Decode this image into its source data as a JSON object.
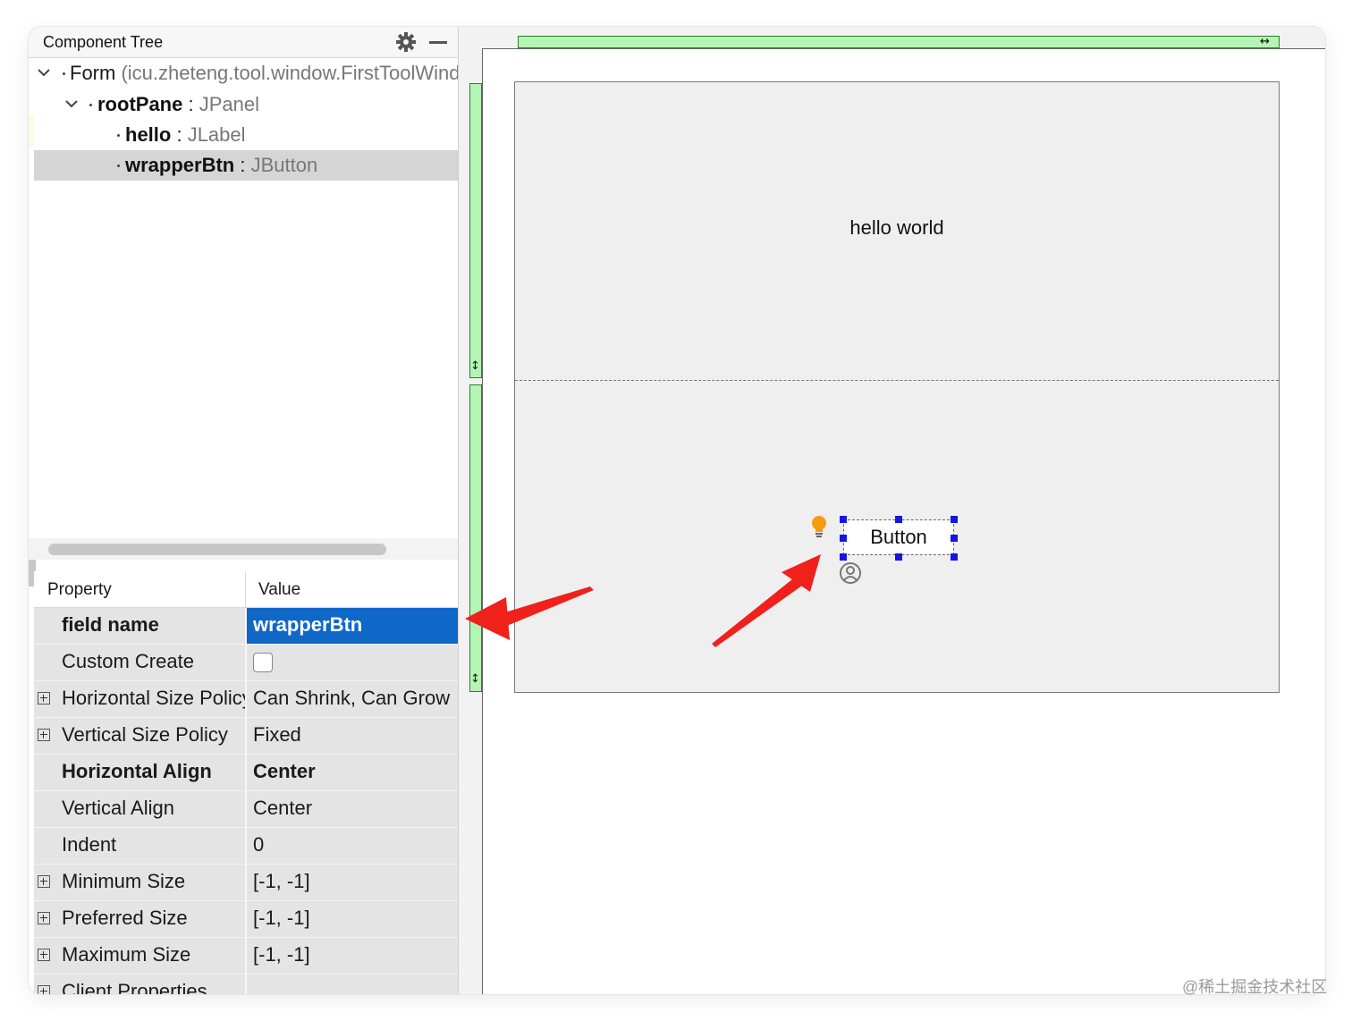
{
  "component_tree": {
    "title": "Component Tree",
    "nodes": [
      {
        "name": "Form",
        "detail": " (icu.zheteng.tool.window.FirstToolWindow)"
      },
      {
        "name": "rootPane",
        "sep": " : ",
        "type": "JPanel"
      },
      {
        "name": "hello",
        "sep": " : ",
        "type": "JLabel"
      },
      {
        "name": "wrapperBtn",
        "sep": " : ",
        "type": "JButton"
      }
    ]
  },
  "properties": {
    "header": {
      "property": "Property",
      "value": "Value"
    },
    "rows": [
      {
        "name": "field name",
        "value": "wrapperBtn"
      },
      {
        "name": "Custom Create",
        "value": ""
      },
      {
        "name": "Horizontal Size Policy",
        "value": "Can Shrink, Can Grow"
      },
      {
        "name": "Vertical Size Policy",
        "value": "Fixed"
      },
      {
        "name": "Horizontal Align",
        "value": "Center"
      },
      {
        "name": "Vertical Align",
        "value": "Center"
      },
      {
        "name": "Indent",
        "value": "0"
      },
      {
        "name": "Minimum Size",
        "value": "[-1, -1]"
      },
      {
        "name": "Preferred Size",
        "value": "[-1, -1]"
      },
      {
        "name": "Maximum Size",
        "value": "[-1, -1]"
      },
      {
        "name": "Client Properties",
        "value": ""
      }
    ]
  },
  "designer": {
    "label_text": "hello world",
    "button_text": "Button",
    "arrow_h": "↔",
    "arrow_v": "↕"
  },
  "colors": {
    "selection_blue": "#0f67c8",
    "grid_green": "#b4f5b4",
    "handle_blue": "#1515e6",
    "annotation_red": "#f0201a"
  },
  "watermark": "@稀土掘金技术社区"
}
